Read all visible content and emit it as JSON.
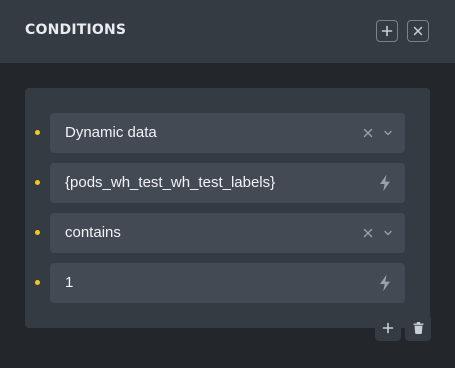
{
  "header": {
    "title": "CONDITIONS",
    "add_icon": "plus-icon",
    "close_icon": "close-icon"
  },
  "conditions": [
    {
      "value": "Dynamic data",
      "kind": "select",
      "icons": [
        "clear-icon",
        "chevron-down-icon"
      ]
    },
    {
      "value": "{pods_wh_test_wh_test_labels}",
      "kind": "dynamic-input",
      "icons": [
        "bolt-icon"
      ]
    },
    {
      "value": "contains",
      "kind": "select",
      "icons": [
        "clear-icon",
        "chevron-down-icon"
      ]
    },
    {
      "value": "1",
      "kind": "dynamic-input",
      "icons": [
        "bolt-icon"
      ]
    }
  ],
  "footer": {
    "add_icon": "plus-icon",
    "delete_icon": "trash-icon"
  },
  "colors": {
    "accent_dot": "#f3c623",
    "header_bg": "#353b43",
    "panel_bg": "#23272b",
    "field_bg": "#434a54"
  }
}
